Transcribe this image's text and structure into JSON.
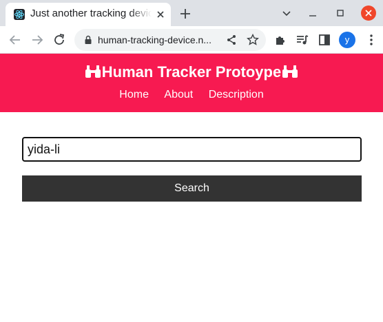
{
  "browser": {
    "tab_title": "Just another tracking device",
    "url": "human-tracking-device.n...",
    "profile_initial": "y"
  },
  "site": {
    "title": "Human Tracker Protoype",
    "nav": [
      "Home",
      "About",
      "Description"
    ]
  },
  "search": {
    "value": "yida-li",
    "button_label": "Search"
  },
  "colors": {
    "header_bg": "#f71a51",
    "button_bg": "#333333",
    "profile": "#1a73e8"
  }
}
